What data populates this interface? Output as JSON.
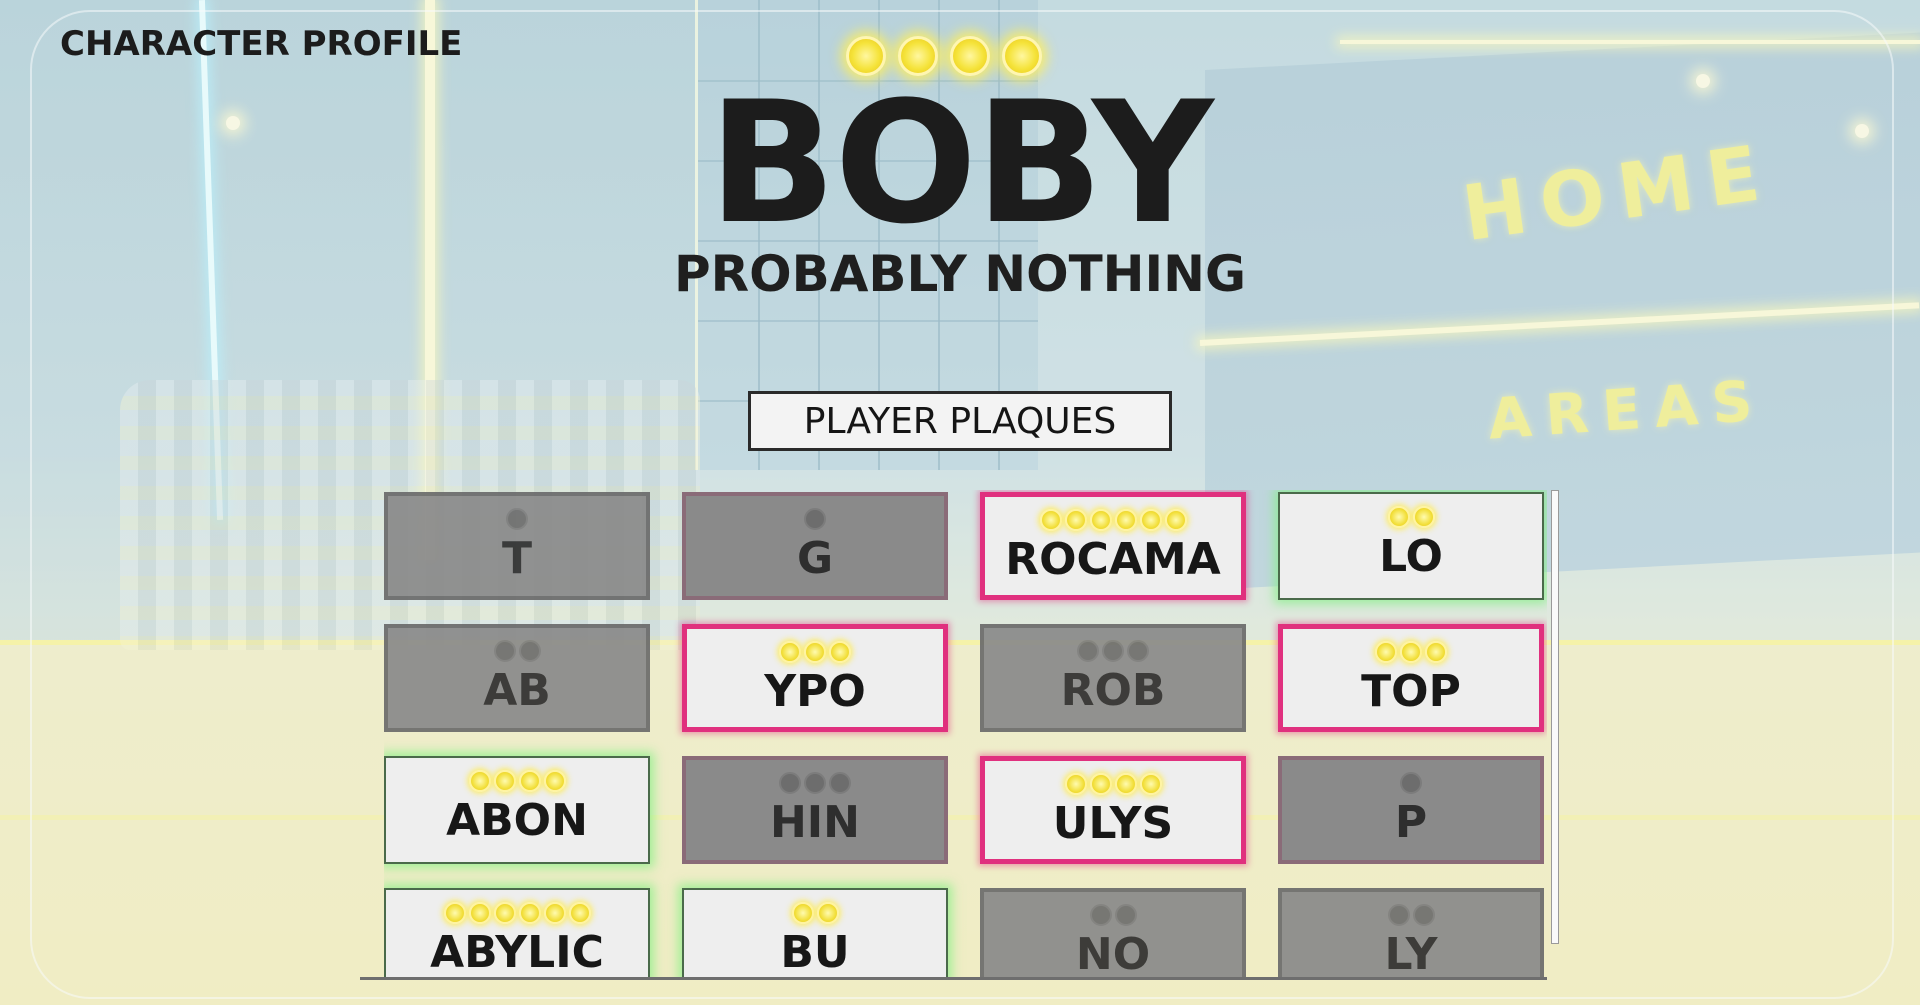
{
  "screen": {
    "title": "CHARACTER PROFILE"
  },
  "player": {
    "name": "BOBY",
    "subtitle": "PROBABLY NOTHING",
    "star_count": 4
  },
  "section": {
    "button_label": "PLAYER PLAQUES"
  },
  "world_signs": {
    "home": "HOME",
    "areas": "AREAS"
  },
  "plaques": [
    {
      "label": "T",
      "stars": 1,
      "style": "locked"
    },
    {
      "label": "G",
      "stars": 1,
      "style": "locked-pink"
    },
    {
      "label": "ROCAMA",
      "stars": 6,
      "style": "pink"
    },
    {
      "label": "LO",
      "stars": 2,
      "style": "green"
    },
    {
      "label": "AB",
      "stars": 2,
      "style": "locked"
    },
    {
      "label": "YPO",
      "stars": 3,
      "style": "pink"
    },
    {
      "label": "ROB",
      "stars": 3,
      "style": "locked"
    },
    {
      "label": "TOP",
      "stars": 3,
      "style": "pink"
    },
    {
      "label": "ABON",
      "stars": 4,
      "style": "green"
    },
    {
      "label": "HIN",
      "stars": 3,
      "style": "locked-pink"
    },
    {
      "label": "ULYS",
      "stars": 4,
      "style": "pink"
    },
    {
      "label": "P",
      "stars": 1,
      "style": "locked-pink"
    },
    {
      "label": "ABYLIC",
      "stars": 6,
      "style": "green"
    },
    {
      "label": "BU",
      "stars": 2,
      "style": "green"
    },
    {
      "label": "NO",
      "stars": 2,
      "style": "locked"
    },
    {
      "label": "LY",
      "stars": 2,
      "style": "locked"
    }
  ],
  "colors": {
    "unlocked_green_glow": "#82f082",
    "rare_pink_border": "#e0307e",
    "locked_gray": "#8a8a8a",
    "star_yellow": "#f5e33a"
  }
}
